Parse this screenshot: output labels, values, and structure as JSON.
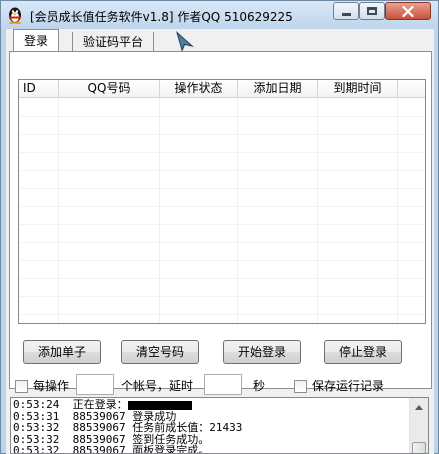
{
  "window": {
    "title": "[会员成长值任务软件v1.8]  作者QQ 510629225"
  },
  "tabs": [
    {
      "label": "登录"
    },
    {
      "label": "验证码平台"
    }
  ],
  "table": {
    "columns": [
      "ID",
      "QQ号码",
      "操作状态",
      "添加日期",
      "到期时间"
    ],
    "rows": []
  },
  "buttons": {
    "add": "添加单子",
    "clear": "清空号码",
    "start": "开始登录",
    "stop": "停止登录"
  },
  "options": {
    "per_op_label": "每操作",
    "per_op_value": "",
    "accounts_delay_label": "个帐号，延时",
    "delay_value": "",
    "seconds_label": "秒",
    "save_log_label": "保存运行记录"
  },
  "log": [
    {
      "time": "0:53:24",
      "text": "正在登录：",
      "redacted": true
    },
    {
      "time": "0:53:31",
      "text": "88539067 登录成功",
      "redacted": false
    },
    {
      "time": "0:53:32",
      "text": "88539067 任务前成长值：21433",
      "redacted": false
    },
    {
      "time": "0:53:32",
      "text": "88539067 签到任务成功。",
      "redacted": false
    },
    {
      "time": "0:53:32",
      "text": "88539067 面板登录完成。",
      "redacted": false
    }
  ],
  "colors": {
    "frame": "#bcd3ea",
    "client": "#f0f0f0",
    "close_button": "#c7513a"
  },
  "icons": {
    "app": "penguin-icon",
    "cursor": "arrow-cursor-icon"
  }
}
